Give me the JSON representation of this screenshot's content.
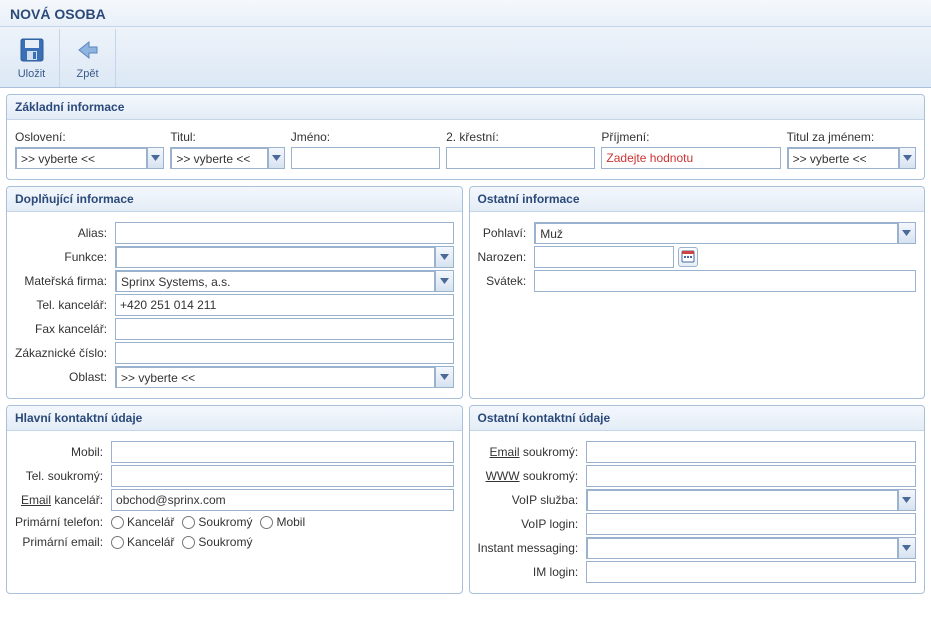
{
  "title": "NOVÁ OSOBA",
  "toolbar": {
    "save_label": "Uložit",
    "back_label": "Zpět"
  },
  "panels": {
    "basic": "Základní informace",
    "additional": "Doplňující informace",
    "other_info": "Ostatní informace",
    "main_contact": "Hlavní kontaktní údaje",
    "other_contact": "Ostatní kontaktní údaje"
  },
  "basic": {
    "salutation_label": "Oslovení:",
    "salutation_value": ">> vyberte <<",
    "title_label": "Titul:",
    "title_value": ">> vyberte <<",
    "first_label": "Jméno:",
    "first_value": "",
    "middle_label": "2. křestní:",
    "middle_value": "",
    "last_label": "Příjmení:",
    "last_placeholder": "Zadejte hodnotu",
    "last_value": "",
    "suffix_label": "Titul za jménem:",
    "suffix_value": ">> vyberte <<"
  },
  "additional": {
    "alias_label": "Alias:",
    "alias_value": "",
    "function_label": "Funkce:",
    "function_value": "",
    "company_label": "Mateřská firma:",
    "company_value": "Sprinx Systems, a.s.",
    "tel_office_label": "Tel. kancelář:",
    "tel_office_value": "+420 251 014 211",
    "fax_office_label": "Fax kancelář:",
    "fax_office_value": "",
    "customer_no_label": "Zákaznické číslo:",
    "customer_no_value": "",
    "area_label": "Oblast:",
    "area_value": ">> vyberte <<"
  },
  "other_info": {
    "gender_label": "Pohlaví:",
    "gender_value": "Muž",
    "born_label": "Narozen:",
    "born_value": "",
    "nameday_label": "Svátek:",
    "nameday_value": ""
  },
  "main_contact": {
    "mobile_label": "Mobil:",
    "mobile_value": "",
    "tel_private_label": "Tel. soukromý:",
    "tel_private_value": "",
    "email_office_label_u": "Email",
    "email_office_label_rest": " kancelář:",
    "email_office_value": "obchod@sprinx.com",
    "primary_phone_label": "Primární telefon:",
    "primary_email_label": "Primární email:",
    "radio_office": "Kancelář",
    "radio_private": "Soukromý",
    "radio_mobile": "Mobil"
  },
  "other_contact": {
    "email_private_label_u": "Email",
    "email_private_label_rest": " soukromý:",
    "email_private_value": "",
    "www_private_label_u": "WWW",
    "www_private_label_rest": " soukromý:",
    "www_private_value": "",
    "voip_service_label": "VoIP služba:",
    "voip_service_value": "",
    "voip_login_label": "VoIP login:",
    "voip_login_value": "",
    "im_label": "Instant messaging:",
    "im_value": "",
    "im_login_label": "IM login:",
    "im_login_value": ""
  }
}
